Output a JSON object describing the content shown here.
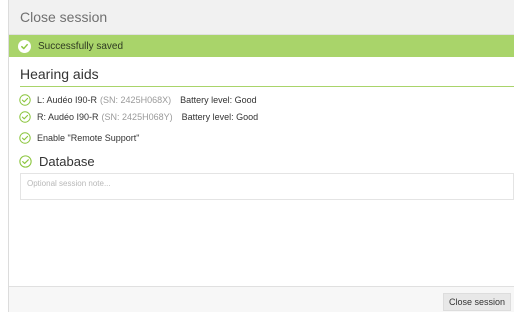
{
  "dialog": {
    "title": "Close session",
    "banner_text": "Successfully saved",
    "hearing_aids_title": "Hearing aids",
    "devices": [
      {
        "side_model": "L: Audéo I90-R",
        "serial": "(SN: 2425H068X)",
        "battery": "Battery level: Good"
      },
      {
        "side_model": "R: Audéo I90-R",
        "serial": "(SN: 2425H068Y)",
        "battery": "Battery level: Good"
      }
    ],
    "remote_support": "Enable \"Remote Support\"",
    "database_title": "Database",
    "note_placeholder": "Optional session note...",
    "close_button": "Close session"
  },
  "colors": {
    "accent_green": "#a9d46a",
    "check_green": "#8cc63f"
  },
  "icons": {
    "banner": "check-circle-icon",
    "status": "check-circle-outline-icon"
  }
}
